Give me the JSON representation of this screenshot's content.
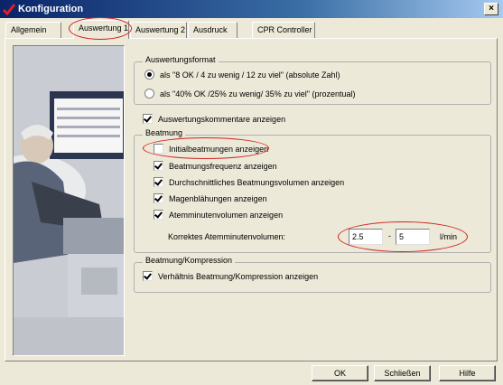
{
  "window": {
    "title": "Konfiguration",
    "close_symbol": "×"
  },
  "tabs": [
    {
      "label": "Allgemein",
      "active": false
    },
    {
      "label": "Auswertung 1",
      "active": true
    },
    {
      "label": "Auswertung 2",
      "active": false
    },
    {
      "label": "Ausdruck",
      "active": false
    },
    {
      "label": "CPR Controller",
      "active": false
    }
  ],
  "auswertungsformat": {
    "title": "Auswertungsformat",
    "options": [
      {
        "label": "als \"8 OK / 4 zu wenig / 12 zu viel\" (absolute Zahl)",
        "selected": true
      },
      {
        "label": "als \"40% OK /25% zu wenig/ 35% zu viel\" (prozentual)",
        "selected": false
      }
    ]
  },
  "kommentare": {
    "label": "Auswertungskommentare anzeigen",
    "checked": true
  },
  "beatmung": {
    "title": "Beatmung",
    "items": [
      {
        "label": "Initialbeatmungen anzeigen",
        "checked": false
      },
      {
        "label": "Beatmungsfrequenz anzeigen",
        "checked": true
      },
      {
        "label": "Durchschnittliches Beatmungsvolumen anzeigen",
        "checked": true
      },
      {
        "label": "Magenblähungen anzeigen",
        "checked": true
      },
      {
        "label": "Atemminutenvolumen anzeigen",
        "checked": true
      }
    ],
    "volume_label": "Korrektes Atemminutenvolumen:",
    "volume_min": "2.5",
    "volume_separator": "-",
    "volume_max": "5",
    "volume_unit": "l/min"
  },
  "kompression": {
    "title": "Beatmung/Kompression",
    "item": {
      "label": "Verhältnis Beatmung/Kompression anzeigen",
      "checked": true
    }
  },
  "buttons": {
    "ok": "OK",
    "close": "Schließen",
    "help": "Hilfe"
  },
  "colors": {
    "titlebar": "#0a246a",
    "annotation": "#d02020",
    "dialog_bg": "#ece9d8"
  },
  "icons": {
    "app": "red-check-icon",
    "close": "close-icon"
  }
}
